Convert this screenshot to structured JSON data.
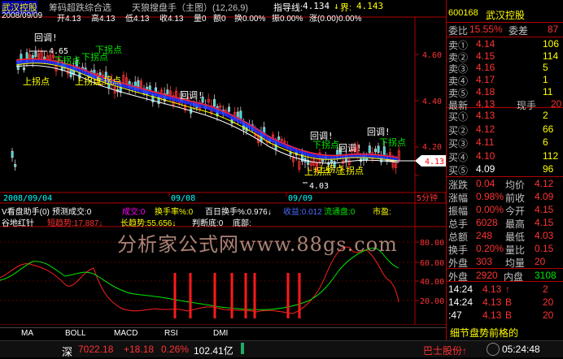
{
  "header": {
    "stock_name": "武汉控股",
    "indicator_name": "筹码超跌综合选",
    "formula": "天狼搜盘手（主图）(12,26,9)",
    "guide_label": "指导线:",
    "guide_value": "4.134",
    "bound_label": "界:",
    "bound_value": "4.143"
  },
  "ohlc_line": {
    "date": "2008/09/09",
    "open": "开4.13",
    "high": "高4.13",
    "low": "低4.13",
    "close": "收4.13",
    "volume": "量0",
    "amount": "额0",
    "turnover": "换0.00%",
    "amplitude": "振0.00%",
    "change": "涨(0.00)0.00%"
  },
  "main_chart": {
    "price_ticks": [
      "4.60",
      "4.40",
      "4.20"
    ],
    "last_price_tag": "4.13",
    "high_mark": "4.65",
    "low_mark": "4.03",
    "annotations": {
      "huidiao_1": "回调!",
      "xiaguaidian_1": "下拐点",
      "xiaguaidian_2": "下拐点",
      "xiaguaidian_3": "下拐点",
      "shangguaidian_1": "上拐点",
      "shangguaidian_2": "上拐点",
      "shangguaidian_3": "上拐点",
      "huidiao_2": "回调!",
      "huidiao_3": "回调!",
      "xiaguaidian_4": "下拐点",
      "huidiao_4": "回调!",
      "huidiao_5": "回调!",
      "xiaguaidian_5": "下拐点",
      "shangguaidian_4": "上拐点",
      "shangguaidian_5": "上拐点",
      "shangguaidian_6": "上拐点"
    },
    "date_axis": [
      "2008/09/04",
      "09/08",
      "09/09"
    ],
    "period": "5分钟"
  },
  "indicator_header": {
    "name": "V看盘助手(0)",
    "items": [
      {
        "text": "预测成交:0",
        "color": "#ffffff"
      },
      {
        "text": "成交:0",
        "color": "#ff00ff"
      },
      {
        "text": "换手率%:0",
        "color": "#ffff00"
      },
      {
        "text": "百日换手%:0.976↓",
        "color": "#ffffff"
      },
      {
        "text": "收益:0.012",
        "color": "#4a6cff"
      },
      {
        "text": "流通盘:0",
        "color": "#00e600"
      },
      {
        "text": "市盈:",
        "color": "#ffff00"
      }
    ]
  },
  "sub_indicator": {
    "name": "谷地红针",
    "items": [
      {
        "text": "短趋势:17.887↓",
        "color": "#ff3232"
      },
      {
        "text": "长趋势:55.656↓",
        "color": "#ffff00"
      },
      {
        "text": "判断底:0",
        "color": "#ffffff"
      },
      {
        "text": "底部:",
        "color": "#ffffff"
      }
    ],
    "ticks": [
      "80.00",
      "60.00",
      "40.00",
      "20.00"
    ]
  },
  "watermark": "分析家公式网www.88gs.com",
  "tabs": [
    "MA",
    "BOLL",
    "MACD",
    "RSI",
    "DMI"
  ],
  "right_panel": {
    "code": "600168",
    "name": "武汉控股",
    "weibi_label": "委比",
    "weibi_value": "15.55%",
    "weicha_label": "委差",
    "weicha_value": "87",
    "asks": [
      {
        "label": "卖⑤",
        "price": "4.18",
        "vol": "11"
      },
      {
        "label": "卖④",
        "price": "4.17",
        "vol": "1"
      },
      {
        "label": "卖③",
        "price": "4.16",
        "vol": "5"
      },
      {
        "label": "卖②",
        "price": "4.15",
        "vol": "114"
      },
      {
        "label": "卖①",
        "price": "4.14",
        "vol": "106"
      }
    ],
    "latest_label": "最新",
    "latest_value": "4.13",
    "xianshou_label": "现手",
    "xianshou_value": "20",
    "bids": [
      {
        "label": "买①",
        "price": "4.13",
        "vol": "2"
      },
      {
        "label": "买②",
        "price": "4.12",
        "vol": "66"
      },
      {
        "label": "买③",
        "price": "4.11",
        "vol": "6"
      },
      {
        "label": "买④",
        "price": "4.10",
        "vol": "112"
      },
      {
        "label": "买⑤",
        "price": "4.09",
        "vol": "96"
      }
    ],
    "stats": [
      {
        "l1": "涨跌",
        "v1": "0.04",
        "l2": "均价",
        "v2": "4.12"
      },
      {
        "l1": "涨幅",
        "v1": "0.98%",
        "l2": "前收",
        "v2": "4.09"
      },
      {
        "l1": "振幅",
        "v1": "0.00%",
        "l2": "今开",
        "v2": "4.15"
      },
      {
        "l1": "总手",
        "v1": "6028",
        "l2": "最高",
        "v2": "4.15"
      },
      {
        "l1": "总额",
        "v1": "248",
        "l2": "最低",
        "v2": "4.03"
      },
      {
        "l1": "换手",
        "v1": "0.20%",
        "l2": "量比",
        "v2": "0.15"
      },
      {
        "l1": "外盘",
        "v1": "303",
        "l2": "均量",
        "v2": "20"
      }
    ],
    "waipan_label": "外盘",
    "waipan_value": "2920",
    "neipan_label": "内盘",
    "neipan_value": "3108",
    "ticks": [
      {
        "time": "14:24",
        "price": "4.13",
        "vol": "2",
        "dir": "↑"
      },
      {
        "time": "14:24",
        "price": "4.13",
        "vol": "20",
        "dir": "B"
      },
      {
        "time": ":47",
        "price": "4.13",
        "vol": "20",
        "dir": "B"
      }
    ],
    "bottom_text": "细节盘势前格的"
  },
  "statusbar": {
    "market": "深",
    "index_value": "7022.18",
    "index_change": "+18.18",
    "index_pct": "0.26%",
    "amount": "102.41亿",
    "stock_tag": "巴士股份↑",
    "time": "05:24:48"
  }
}
